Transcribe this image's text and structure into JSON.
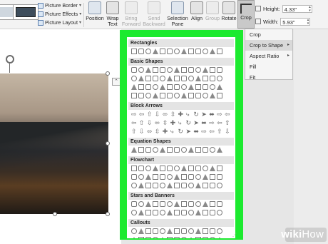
{
  "ribbon": {
    "picture_commands": [
      {
        "label": "Picture Border",
        "icon": "picture-border-icon"
      },
      {
        "label": "Picture Effects",
        "icon": "picture-effects-icon"
      },
      {
        "label": "Picture Layout",
        "icon": "picture-layout-icon"
      }
    ],
    "position_label": "Position",
    "wrap_text_label_1": "Wrap",
    "wrap_text_label_2": "Text",
    "bring_forward_label_1": "Bring",
    "bring_forward_label_2": "Forward",
    "send_backward_label_1": "Send",
    "send_backward_label_2": "Backward",
    "selection_pane_label_1": "Selection",
    "selection_pane_label_2": "Pane",
    "align_label": "Align",
    "group_label": "Group",
    "rotate_label": "Rotate",
    "crop_label": "Crop",
    "height_label": "Height:",
    "height_value": "4.33\"",
    "width_label": "Width:",
    "width_value": "5.93\""
  },
  "crop_menu": {
    "items": [
      {
        "label": "Crop",
        "submenu": false
      },
      {
        "label": "Crop to Shape",
        "submenu": true,
        "active": true
      },
      {
        "label": "Aspect Ratio",
        "submenu": true
      },
      {
        "label": "Fill",
        "submenu": false
      },
      {
        "label": "Fit",
        "submenu": false
      }
    ]
  },
  "shape_gallery": {
    "categories": [
      {
        "label": "Rectangles",
        "rows": 1
      },
      {
        "label": "Basic Shapes",
        "rows": 4
      },
      {
        "label": "Block Arrows",
        "rows": 3
      },
      {
        "label": "Equation Shapes",
        "rows": 1
      },
      {
        "label": "Flowchart",
        "rows": 3
      },
      {
        "label": "Stars and Banners",
        "rows": 2
      },
      {
        "label": "Callouts",
        "rows": 2
      }
    ]
  },
  "watermark": {
    "wiki": "wiki",
    "how": "How"
  },
  "colors": {
    "highlight": "#1cea2f",
    "ribbon_bg": "#f3f3f3",
    "menu_active": "#d9d9d9"
  }
}
